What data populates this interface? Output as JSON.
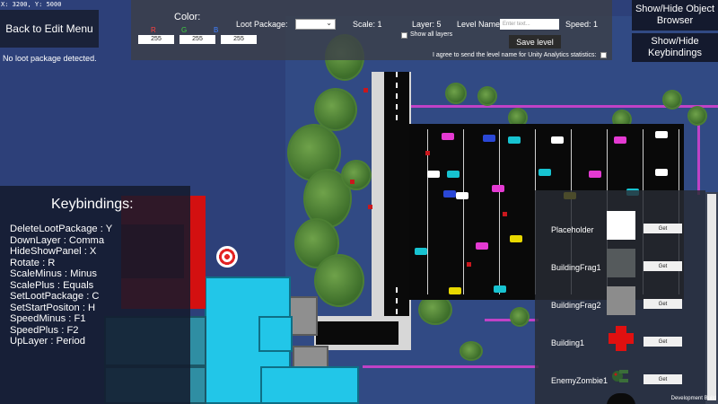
{
  "hud": {
    "coords": "X: 3200, Y: 5000",
    "back_button": "Back to Edit Menu",
    "loot_status": "No loot package detected."
  },
  "top_panel": {
    "color_label": "Color:",
    "r_label": "R",
    "g_label": "G",
    "b_label": "B",
    "r_value": "255",
    "g_value": "255",
    "b_value": "255",
    "loot_package_label": "Loot Package:",
    "scale_label": "Scale: 1",
    "layer_label": "Layer: 5",
    "level_name_label": "Level Name:",
    "level_name_placeholder": "Enter text...",
    "speed_label": "Speed: 1",
    "show_all_layers": "Show all layers",
    "save_button": "Save level",
    "analytics_text": "I agree to send the level name for Unity Analytics statistics:"
  },
  "right_buttons": {
    "object_browser": "Show/Hide Object Browser",
    "keybindings": "Show/Hide Keybindings"
  },
  "keybindings": {
    "title": "Keybindings:",
    "items": [
      "DeleteLootPackage : Y",
      "DownLayer : Comma",
      "HideShowPanel : X",
      "Rotate : R",
      "ScaleMinus : Minus",
      "ScalePlus : Equals",
      "SetLootPackage : C",
      "SetStartPositon : H",
      "SpeedMinus : F1",
      "SpeedPlus : F2",
      "UpLayer : Period"
    ]
  },
  "object_browser": {
    "get_label": "Get",
    "items": [
      {
        "name": "Placeholder",
        "preview_color": "#ffffff"
      },
      {
        "name": "BuildingFrag1",
        "preview_color": "#555a5c"
      },
      {
        "name": "BuildingFrag2",
        "preview_color": "#8c8c8c"
      },
      {
        "name": "Building1",
        "preview_color": "#e01010"
      },
      {
        "name": "EnemyZombie1",
        "preview_color": "#3b6e3a"
      }
    ]
  },
  "footer": {
    "dev_build": "Development Build"
  },
  "colors": {
    "water": "#2d4079",
    "grass": "#314a84",
    "road": "#0a0a0a",
    "building_cyan": "#22c6e8",
    "building_red": "#d31010",
    "fence": "#c042c6"
  }
}
